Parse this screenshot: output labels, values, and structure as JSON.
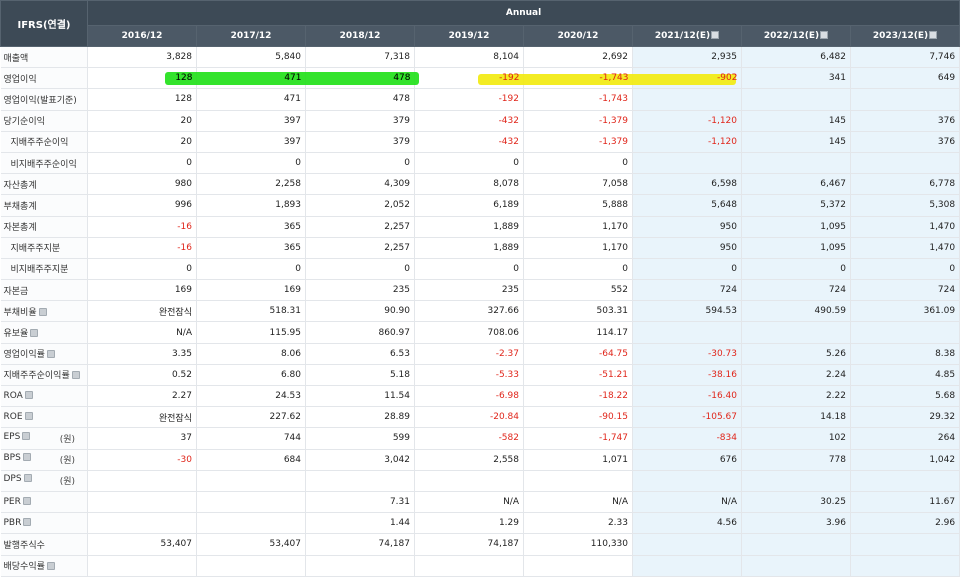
{
  "header": {
    "corner": "IFRS(연결)",
    "group": "Annual",
    "periods": [
      "2016/12",
      "2017/12",
      "2018/12",
      "2019/12",
      "2020/12",
      "2021/12(E)",
      "2022/12(E)",
      "2023/12(E)"
    ]
  },
  "colors": {
    "header_bg": "#3d4a56",
    "negative": "#e0261b",
    "estimate_bg": "#e9f4fb",
    "highlight_green": "#22e11a",
    "highlight_yellow": "#f2ea11"
  },
  "rows": [
    {
      "label": "매출액",
      "vals": [
        "3,828",
        "5,840",
        "7,318",
        "8,104",
        "2,692",
        "2,935",
        "6,482",
        "7,746"
      ]
    },
    {
      "label": "영업이익",
      "vals": [
        "128",
        "471",
        "478",
        "-192",
        "-1,743",
        "-902",
        "341",
        "649"
      ]
    },
    {
      "label": "영업이익(발표기준)",
      "vals": [
        "128",
        "471",
        "478",
        "-192",
        "-1,743",
        "",
        "",
        ""
      ]
    },
    {
      "label": "당기순이익",
      "vals": [
        "20",
        "397",
        "379",
        "-432",
        "-1,379",
        "-1,120",
        "145",
        "376"
      ]
    },
    {
      "label": "지배주주순이익",
      "vals": [
        "20",
        "397",
        "379",
        "-432",
        "-1,379",
        "-1,120",
        "145",
        "376"
      ]
    },
    {
      "label": "비지배주주순이익",
      "vals": [
        "0",
        "0",
        "0",
        "0",
        "0",
        "",
        "",
        ""
      ]
    },
    {
      "label": "자산총계",
      "vals": [
        "980",
        "2,258",
        "4,309",
        "8,078",
        "7,058",
        "6,598",
        "6,467",
        "6,778"
      ]
    },
    {
      "label": "부채총계",
      "vals": [
        "996",
        "1,893",
        "2,052",
        "6,189",
        "5,888",
        "5,648",
        "5,372",
        "5,308"
      ]
    },
    {
      "label": "자본총계",
      "vals": [
        "-16",
        "365",
        "2,257",
        "1,889",
        "1,170",
        "950",
        "1,095",
        "1,470"
      ]
    },
    {
      "label": "지배주주지분",
      "vals": [
        "-16",
        "365",
        "2,257",
        "1,889",
        "1,170",
        "950",
        "1,095",
        "1,470"
      ]
    },
    {
      "label": "비지배주주지분",
      "vals": [
        "0",
        "0",
        "0",
        "0",
        "0",
        "0",
        "0",
        "0"
      ]
    },
    {
      "label": "자본금",
      "vals": [
        "169",
        "169",
        "235",
        "235",
        "552",
        "724",
        "724",
        "724"
      ]
    },
    {
      "label": "부채비율",
      "vals": [
        "완전잠식",
        "518.31",
        "90.90",
        "327.66",
        "503.31",
        "594.53",
        "490.59",
        "361.09"
      ]
    },
    {
      "label": "유보율",
      "vals": [
        "N/A",
        "115.95",
        "860.97",
        "708.06",
        "114.17",
        "",
        "",
        ""
      ]
    },
    {
      "label": "영업이익률",
      "vals": [
        "3.35",
        "8.06",
        "6.53",
        "-2.37",
        "-64.75",
        "-30.73",
        "5.26",
        "8.38"
      ]
    },
    {
      "label": "지배주주순이익률",
      "vals": [
        "0.52",
        "6.80",
        "5.18",
        "-5.33",
        "-51.21",
        "-38.16",
        "2.24",
        "4.85"
      ]
    },
    {
      "label": "ROA",
      "vals": [
        "2.27",
        "24.53",
        "11.54",
        "-6.98",
        "-18.22",
        "-16.40",
        "2.22",
        "5.68"
      ]
    },
    {
      "label": "ROE",
      "vals": [
        "완전잠식",
        "227.62",
        "28.89",
        "-20.84",
        "-90.15",
        "-105.67",
        "14.18",
        "29.32"
      ]
    },
    {
      "label": "EPS",
      "unit": "(원)",
      "vals": [
        "37",
        "744",
        "599",
        "-582",
        "-1,747",
        "-834",
        "102",
        "264"
      ]
    },
    {
      "label": "BPS",
      "unit": "(원)",
      "vals": [
        "-30",
        "684",
        "3,042",
        "2,558",
        "1,071",
        "676",
        "778",
        "1,042"
      ]
    },
    {
      "label": "DPS",
      "unit": "(원)",
      "vals": [
        "",
        "",
        "",
        "",
        "",
        "",
        "",
        ""
      ]
    },
    {
      "label": "PER",
      "vals": [
        "",
        "",
        "7.31",
        "N/A",
        "N/A",
        "N/A",
        "30.25",
        "11.67"
      ]
    },
    {
      "label": "PBR",
      "vals": [
        "",
        "",
        "1.44",
        "1.29",
        "2.33",
        "4.56",
        "3.96",
        "2.96"
      ]
    },
    {
      "label": "발행주식수",
      "vals": [
        "53,407",
        "53,407",
        "74,187",
        "74,187",
        "110,330",
        "",
        "",
        ""
      ]
    },
    {
      "label": "배당수익률",
      "vals": [
        "",
        "",
        "",
        "",
        "",
        "",
        "",
        ""
      ]
    }
  ]
}
